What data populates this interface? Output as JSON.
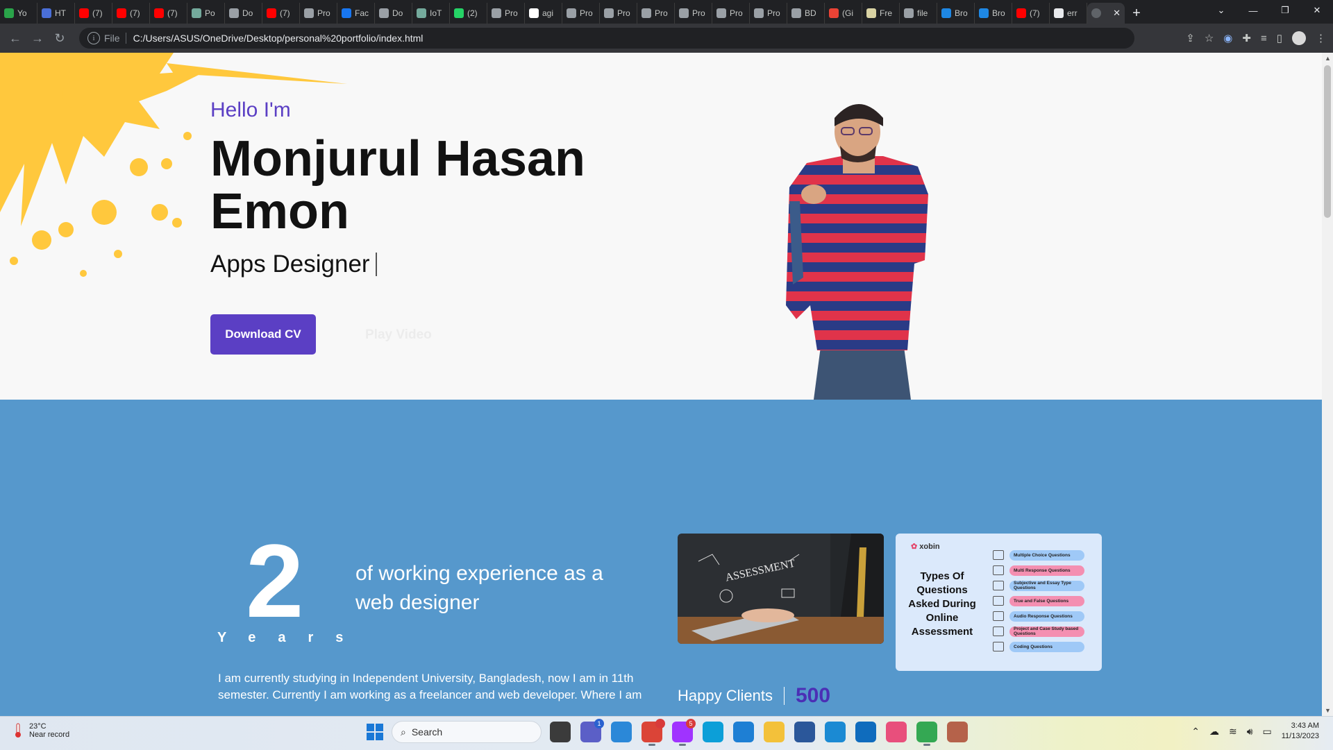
{
  "browser": {
    "tabs": [
      {
        "label": "Yo",
        "color": "#2aa44a"
      },
      {
        "label": "HT",
        "color": "#4a6fd8"
      },
      {
        "label": "(7)",
        "color": "#ff0000"
      },
      {
        "label": "(7)",
        "color": "#ff0000"
      },
      {
        "label": "(7)",
        "color": "#ff0000"
      },
      {
        "label": "Po",
        "color": "#74aa9c"
      },
      {
        "label": "Do",
        "color": "#9aa0a6"
      },
      {
        "label": "(7)",
        "color": "#ff0000"
      },
      {
        "label": "Pro",
        "color": "#9aa0a6"
      },
      {
        "label": "Fac",
        "color": "#1877f2"
      },
      {
        "label": "Do",
        "color": "#9aa0a6"
      },
      {
        "label": "IoT",
        "color": "#74aa9c"
      },
      {
        "label": "(2)",
        "color": "#25d366"
      },
      {
        "label": "Pro",
        "color": "#9aa0a6"
      },
      {
        "label": "agi",
        "color": "#ffffff"
      },
      {
        "label": "Pro",
        "color": "#9aa0a6"
      },
      {
        "label": "Pro",
        "color": "#9aa0a6"
      },
      {
        "label": "Pro",
        "color": "#9aa0a6"
      },
      {
        "label": "Pro",
        "color": "#9aa0a6"
      },
      {
        "label": "Pro",
        "color": "#9aa0a6"
      },
      {
        "label": "Pro",
        "color": "#9aa0a6"
      },
      {
        "label": "BD",
        "color": "#9aa0a6"
      },
      {
        "label": "(Gi",
        "color": "#ea4335"
      },
      {
        "label": "Fre",
        "color": "#d9d3a4"
      },
      {
        "label": "file",
        "color": "#9aa0a6"
      },
      {
        "label": "Bro",
        "color": "#1e88e5"
      },
      {
        "label": "Bro",
        "color": "#1e88e5"
      },
      {
        "label": "(7)",
        "color": "#ff0000"
      },
      {
        "label": "err",
        "color": "#e8eaed"
      }
    ],
    "active_tab": {
      "label": "",
      "close": "✕"
    },
    "new_tab": "+",
    "window_controls": [
      "⌄",
      "—",
      "❐",
      "✕"
    ],
    "nav": {
      "back": "←",
      "forward": "→",
      "reload": "↻"
    },
    "address": {
      "info_icon": "i",
      "scheme": "File",
      "url": "C:/Users/ASUS/OneDrive/Desktop/personal%20portfolio/index.html"
    },
    "toolbar_icons": [
      "share-icon",
      "star-icon",
      "extension-circle-icon",
      "puzzle-icon",
      "media-queue-icon",
      "side-panel-icon",
      "profile-avatar",
      "menu-dots-icon"
    ]
  },
  "hero": {
    "greeting": "Hello I'm",
    "name": "Monjurul Hasan Emon",
    "role": "Apps Designer",
    "download_cv": "Download CV",
    "play_video": "Play Video",
    "accent_color": "#5b3fc4",
    "splash_color": "#ffc83d"
  },
  "about": {
    "years_number": "2",
    "years_label": "Years",
    "experience_text": "of working experience as a web designer",
    "paragraph": "I am currently studying in Independent University, Bangladesh, now I am in 11th semester. Currently I am working as a freelancer and web developer. Where I am",
    "background_color": "#5698cc",
    "card1": {
      "caption": "ASSESSMENT"
    },
    "card2": {
      "brand": "xobin",
      "title": "Types Of Questions Asked During Online Assessment",
      "items": [
        {
          "label": "Multiple Choice Questions",
          "color": "#9fc9f7"
        },
        {
          "label": "Multi Response Questions",
          "color": "#f48fb1"
        },
        {
          "label": "Subjective and Essay Type Questions",
          "color": "#9fc9f7"
        },
        {
          "label": "True and False Questions",
          "color": "#f48fb1"
        },
        {
          "label": "Audio Response Questions",
          "color": "#9fc9f7"
        },
        {
          "label": "Project and Case Study based Questions",
          "color": "#f48fb1"
        },
        {
          "label": "Coding Questions",
          "color": "#9fc9f7"
        }
      ]
    },
    "happy_clients_label": "Happy Clients",
    "happy_clients_count": "500"
  },
  "taskbar": {
    "weather_temp": "23°C",
    "weather_desc": "Near record",
    "search_placeholder": "Search",
    "apps": [
      {
        "name": "file-manager-icon",
        "color": "#3b3b3b",
        "running": false
      },
      {
        "name": "teams-chat-icon",
        "color": "#5b5fc7",
        "running": false,
        "badge": "1",
        "badge_style": "blue"
      },
      {
        "name": "screen-icon",
        "color": "#2b88d8",
        "running": false
      },
      {
        "name": "chrome-icon",
        "color": "#db4437",
        "running": true,
        "badge": "",
        "badge_style": "red"
      },
      {
        "name": "messenger-icon",
        "color": "#a033ff",
        "running": true,
        "badge": "5",
        "badge_style": "red"
      },
      {
        "name": "edge-icon",
        "color": "#0c9fd8",
        "running": false
      },
      {
        "name": "photos-icon",
        "color": "#1e7fd4",
        "running": false
      },
      {
        "name": "folder-icon",
        "color": "#f3c13a",
        "running": false
      },
      {
        "name": "word-icon",
        "color": "#2b579a",
        "running": false
      },
      {
        "name": "vscode-icon",
        "color": "#1b8ad3",
        "running": false
      },
      {
        "name": "mail-icon",
        "color": "#0f6cbd",
        "running": false
      },
      {
        "name": "kite-icon",
        "color": "#e84f7c",
        "running": false
      },
      {
        "name": "chrome-profile-icon",
        "color": "#34a853",
        "running": true
      },
      {
        "name": "archive-icon",
        "color": "#b5624a",
        "running": false
      }
    ],
    "tray": [
      "chevron-up-icon",
      "onedrive-icon",
      "wifi-icon",
      "volume-icon",
      "battery-icon"
    ],
    "time": "3:43 AM",
    "date": "11/13/2023"
  }
}
